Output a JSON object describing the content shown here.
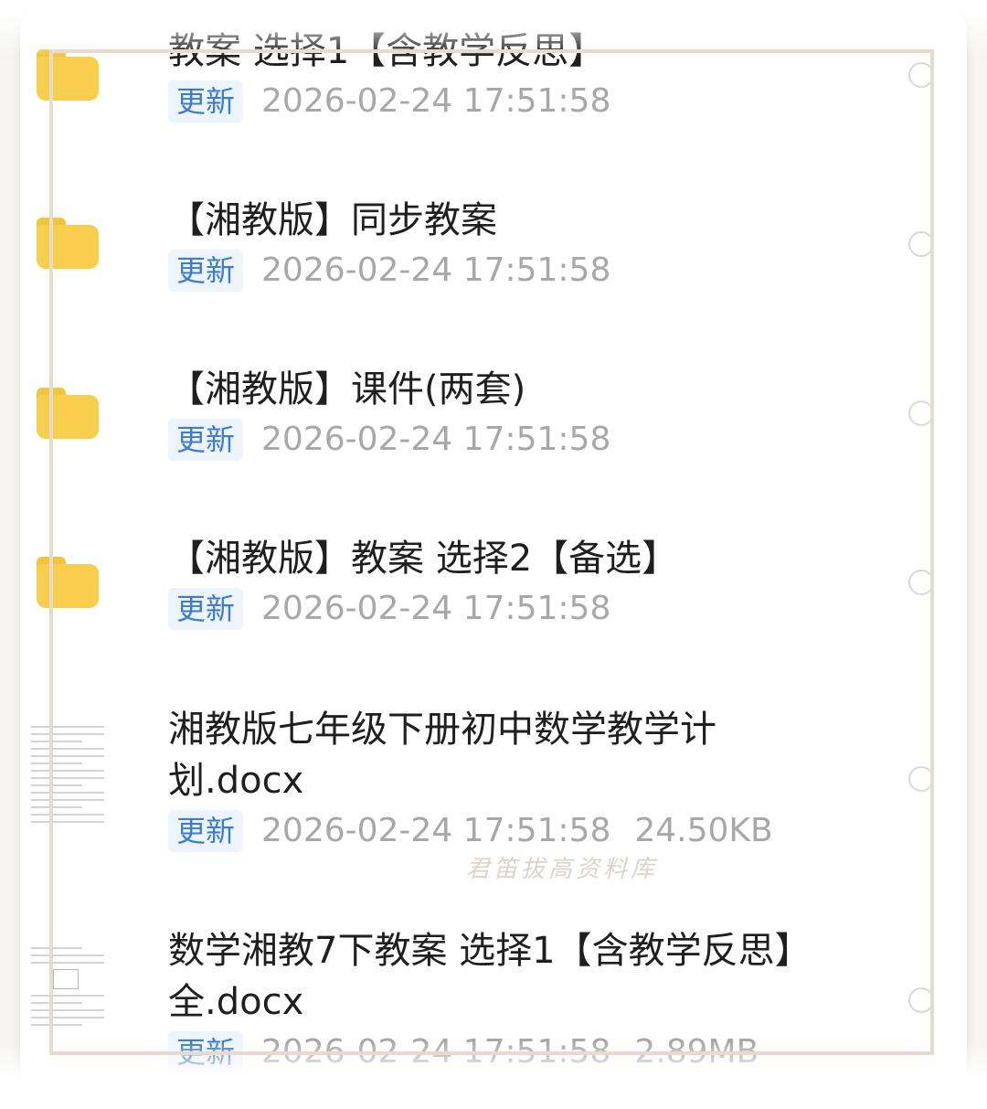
{
  "files": [
    {
      "type": "folder",
      "icon": "folder-icon",
      "title": "教案 选择1【含教学反思】",
      "badge": "更新",
      "timestamp": "2026-02-24  17:51:58"
    },
    {
      "type": "folder",
      "icon": "folder-icon",
      "title": "【湘教版】同步教案",
      "badge": "更新",
      "timestamp": "2026-02-24  17:51:58"
    },
    {
      "type": "folder",
      "icon": "folder-icon",
      "title": "【湘教版】课件(两套)",
      "badge": "更新",
      "timestamp": "2026-02-24  17:51:58"
    },
    {
      "type": "folder",
      "icon": "folder-icon",
      "title": "【湘教版】教案 选择2【备选】",
      "badge": "更新",
      "timestamp": "2026-02-24  17:51:58"
    },
    {
      "type": "file",
      "icon": "docx-thumbnail-icon",
      "title_line1": "湘教版七年级下册初中数学教学计",
      "title_line2": "划.docx",
      "badge": "更新",
      "timestamp": "2026-02-24  17:51:58",
      "size": "24.50KB"
    },
    {
      "type": "file",
      "icon": "docx-thumbnail-icon",
      "title_line1": "数学湘教7下教案 选择1【含教学反思】",
      "title_line2": "全.docx",
      "badge": "更新",
      "timestamp": "2026-02-24  17:51:58",
      "size": "2.89MB"
    }
  ],
  "watermark": "君笛拔高资料库",
  "colors": {
    "folder": "#f7cf4c",
    "badge_text": "#3a7bd5",
    "badge_bg": "#eef4fb",
    "meta_text": "#a8a8a8"
  }
}
